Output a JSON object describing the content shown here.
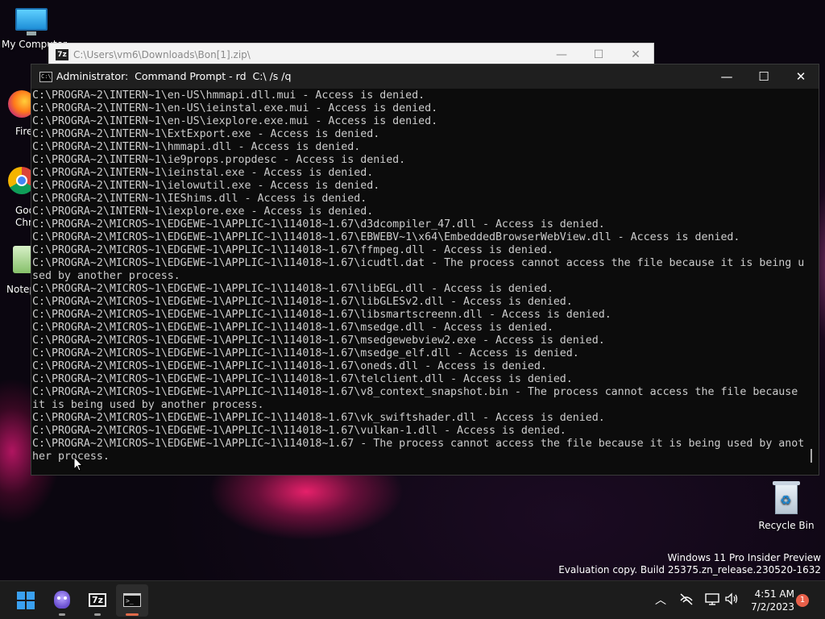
{
  "desktop": {
    "icons": [
      {
        "label": "My Computer"
      },
      {
        "label": "Firefox"
      },
      {
        "label": "Google Chrome"
      },
      {
        "label": "Notepad++"
      },
      {
        "label": "Recycle Bin"
      }
    ]
  },
  "zip_window": {
    "app_icon_text": "7z",
    "title": "C:\\Users\\vm6\\Downloads\\Bon[1].zip\\"
  },
  "cmd_window": {
    "app_icon_text": "C:\\",
    "title": "Administrator:  Command Prompt - rd  C:\\ /s /q",
    "lines": [
      "C:\\PROGRA~2\\INTERN~1\\en-US\\hmmapi.dll.mui - Access is denied.",
      "C:\\PROGRA~2\\INTERN~1\\en-US\\ieinstal.exe.mui - Access is denied.",
      "C:\\PROGRA~2\\INTERN~1\\en-US\\iexplore.exe.mui - Access is denied.",
      "C:\\PROGRA~2\\INTERN~1\\ExtExport.exe - Access is denied.",
      "C:\\PROGRA~2\\INTERN~1\\hmmapi.dll - Access is denied.",
      "C:\\PROGRA~2\\INTERN~1\\ie9props.propdesc - Access is denied.",
      "C:\\PROGRA~2\\INTERN~1\\ieinstal.exe - Access is denied.",
      "C:\\PROGRA~2\\INTERN~1\\ielowutil.exe - Access is denied.",
      "C:\\PROGRA~2\\INTERN~1\\IEShims.dll - Access is denied.",
      "C:\\PROGRA~2\\INTERN~1\\iexplore.exe - Access is denied.",
      "C:\\PROGRA~2\\MICROS~1\\EDGEWE~1\\APPLIC~1\\114018~1.67\\d3dcompiler_47.dll - Access is denied.",
      "C:\\PROGRA~2\\MICROS~1\\EDGEWE~1\\APPLIC~1\\114018~1.67\\EBWEBV~1\\x64\\EmbeddedBrowserWebView.dll - Access is denied.",
      "C:\\PROGRA~2\\MICROS~1\\EDGEWE~1\\APPLIC~1\\114018~1.67\\ffmpeg.dll - Access is denied.",
      "C:\\PROGRA~2\\MICROS~1\\EDGEWE~1\\APPLIC~1\\114018~1.67\\icudtl.dat - The process cannot access the file because it is being u",
      "sed by another process.",
      "C:\\PROGRA~2\\MICROS~1\\EDGEWE~1\\APPLIC~1\\114018~1.67\\libEGL.dll - Access is denied.",
      "C:\\PROGRA~2\\MICROS~1\\EDGEWE~1\\APPLIC~1\\114018~1.67\\libGLESv2.dll - Access is denied.",
      "C:\\PROGRA~2\\MICROS~1\\EDGEWE~1\\APPLIC~1\\114018~1.67\\libsmartscreenn.dll - Access is denied.",
      "C:\\PROGRA~2\\MICROS~1\\EDGEWE~1\\APPLIC~1\\114018~1.67\\msedge.dll - Access is denied.",
      "C:\\PROGRA~2\\MICROS~1\\EDGEWE~1\\APPLIC~1\\114018~1.67\\msedgewebview2.exe - Access is denied.",
      "C:\\PROGRA~2\\MICROS~1\\EDGEWE~1\\APPLIC~1\\114018~1.67\\msedge_elf.dll - Access is denied.",
      "C:\\PROGRA~2\\MICROS~1\\EDGEWE~1\\APPLIC~1\\114018~1.67\\oneds.dll - Access is denied.",
      "C:\\PROGRA~2\\MICROS~1\\EDGEWE~1\\APPLIC~1\\114018~1.67\\telclient.dll - Access is denied.",
      "C:\\PROGRA~2\\MICROS~1\\EDGEWE~1\\APPLIC~1\\114018~1.67\\v8_context_snapshot.bin - The process cannot access the file because",
      "it is being used by another process.",
      "C:\\PROGRA~2\\MICROS~1\\EDGEWE~1\\APPLIC~1\\114018~1.67\\vk_swiftshader.dll - Access is denied.",
      "C:\\PROGRA~2\\MICROS~1\\EDGEWE~1\\APPLIC~1\\114018~1.67\\vulkan-1.dll - Access is denied.",
      "C:\\PROGRA~2\\MICROS~1\\EDGEWE~1\\APPLIC~1\\114018~1.67 - The process cannot access the file because it is being used by anot",
      "her process."
    ]
  },
  "watermark": {
    "line1": "Windows 11 Pro Insider Preview",
    "line2": "Evaluation copy. Build 25375.zn_release.230520-1632"
  },
  "taskbar": {
    "pinned": [
      {
        "name": "Start",
        "icon": "windows-logo-icon"
      },
      {
        "name": "Copilot app",
        "icon": "purple-mascot-icon"
      },
      {
        "name": "7-Zip",
        "icon": "7zip-icon",
        "text": "7z"
      },
      {
        "name": "Command Prompt",
        "icon": "terminal-icon",
        "active": true
      }
    ],
    "tray": {
      "time": "4:51 AM",
      "date": "7/2/2023",
      "notification_count": "1"
    }
  },
  "colors": {
    "cmd_text": "#cccccc",
    "cmd_background": "#0c0c0c",
    "accent_blue": "#3aa0f0",
    "notification_badge": "#e8604a"
  }
}
